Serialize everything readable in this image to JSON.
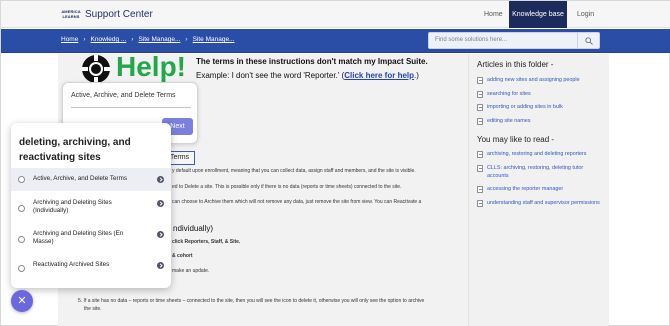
{
  "header": {
    "logo_text": "AMERICA LEARNS",
    "brand": "Support Center",
    "nav": {
      "home": "Home",
      "knowledge_base": "Knowledge base",
      "login": "Login"
    }
  },
  "breadcrumb": [
    "Home",
    "Knowledg ...",
    "Site Manage...",
    "Site Manage..."
  ],
  "search": {
    "placeholder": "Find some solutions here..."
  },
  "article": {
    "help_word": "Help!",
    "help_line1": "The terms in these instructions don't match my Impact Suite.",
    "help_line2_prefix": "Example: I don't see the word 'Reporter.' (",
    "help_link": "Click here for help",
    "help_line2_suffix": ".)",
    "terms_box": "Terms",
    "lines": [
      "y default upon enrollment, meaning that you can collect data, assign staff and members, and the site is visible.",
      "ed to Delete a site. This is possible only if there is no data (reports or time sheets) connected to the site.",
      "can choose to Archive them which will not remove any data, just remove the site from view. You can Reactivate a",
      "ndividually)",
      "click Reporters, Staff, & Site.",
      "& cohort",
      "make an update.",
      "5. If a site has no data – reports or time sheets – connected to the site, then you will see the icon to delete it, otherwise you will only see the option to archive",
      "the site."
    ]
  },
  "popover": {
    "title": "Active, Archive, and Delete Terms",
    "button": "Next"
  },
  "sidebar": {
    "folder_heading": "Articles in this folder -",
    "folder_items": [
      "adding new sites and assigning people",
      "searching for sites",
      "importing or adding sites in bulk",
      "editing site names"
    ],
    "like_heading": "You may like to read -",
    "like_items": [
      "archiving, restoring and deleting reporters",
      "CLLS: archiving, restoring, deleting tutor accounts",
      "accessing the reporter manager",
      "understanding staff and supervisor permissions"
    ]
  },
  "widget": {
    "title": "deleting, archiving, and reactivating sites",
    "options": [
      "Active, Archive, and Delete Terms",
      "Archiving and Deleting Sites (Individually)",
      "Archiving and Deleting Sites (En Masse)",
      "Reactivating Archived Sites"
    ],
    "close_glyph": "✕"
  },
  "colors": {
    "brand_navy": "#1c2a5c",
    "blue_bar": "#2a4ea5",
    "help_green": "#22a84a",
    "link_blue": "#2f57c3",
    "accent_purple": "#6b67e0"
  }
}
